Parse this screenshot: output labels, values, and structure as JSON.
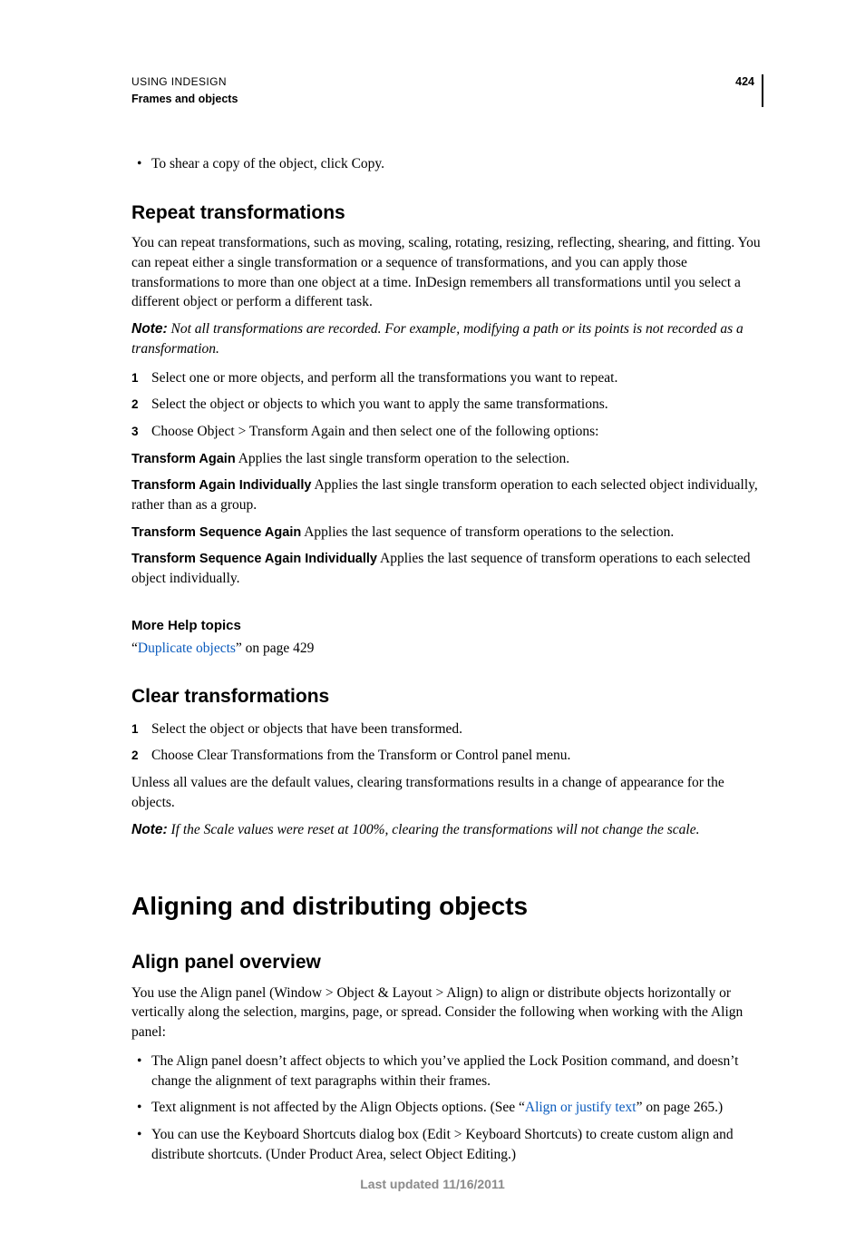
{
  "header": {
    "doc_title": "USING INDESIGN",
    "section": "Frames and objects",
    "page_number": "424"
  },
  "intro_bullet": "To shear a copy of the object, click Copy.",
  "repeat": {
    "heading": "Repeat transformations",
    "para": "You can repeat transformations, such as moving, scaling, rotating, resizing, reflecting, shearing, and fitting. You can repeat either a single transformation or a sequence of transformations, and you can apply those transformations to more than one object at a time. InDesign remembers all transformations until you select a different object or perform a different task.",
    "note_label": "Note:",
    "note_body": " Not all transformations are recorded. For example, modifying a path or its points is not recorded as a transformation.",
    "steps": [
      "Select one or more objects, and perform all the transformations you want to repeat.",
      "Select the object or objects to which you want to apply the same transformations.",
      "Choose Object > Transform Again and then select one of the following options:"
    ],
    "terms": [
      {
        "name": "Transform Again",
        "desc": "   Applies the last single transform operation to the selection."
      },
      {
        "name": "Transform Again Individually",
        "desc": "   Applies the last single transform operation to each selected object individually, rather than as a group."
      },
      {
        "name": "Transform Sequence Again",
        "desc": "   Applies the last sequence of transform operations to the selection."
      },
      {
        "name": "Transform Sequence Again Individually",
        "desc": "   Applies the last sequence of transform operations to each selected object individually."
      }
    ]
  },
  "more_help": {
    "heading": "More Help topics",
    "q_open": "“",
    "link": "Duplicate objects",
    "q_close": "” on page 429"
  },
  "clear": {
    "heading": "Clear transformations",
    "steps": [
      "Select the object or objects that have been transformed.",
      "Choose Clear Transformations from the Transform or Control panel menu."
    ],
    "para": "Unless all values are the default values, clearing transformations results in a change of appearance for the objects.",
    "note_label": "Note:",
    "note_body": " If the Scale values were reset at 100%, clearing the transformations will not change the scale."
  },
  "align": {
    "major_heading": "Aligning and distributing objects",
    "sub_heading": "Align panel overview",
    "para": "You use the Align panel (Window > Object & Layout > Align) to align or distribute objects horizontally or vertically along the selection, margins, page, or spread. Consider the following when working with the Align panel:",
    "bullets": {
      "b1": "The Align panel doesn’t affect objects to which you’ve applied the Lock Position command, and doesn’t change the alignment of text paragraphs within their frames.",
      "b2_pre": "Text alignment is not affected by the Align Objects options. (See “",
      "b2_link": "Align or justify text",
      "b2_post": "” on page 265.)",
      "b3": "You can use the Keyboard Shortcuts dialog box (Edit > Keyboard Shortcuts) to create custom align and distribute shortcuts. (Under Product Area, select Object Editing.)"
    }
  },
  "footer": "Last updated 11/16/2011"
}
